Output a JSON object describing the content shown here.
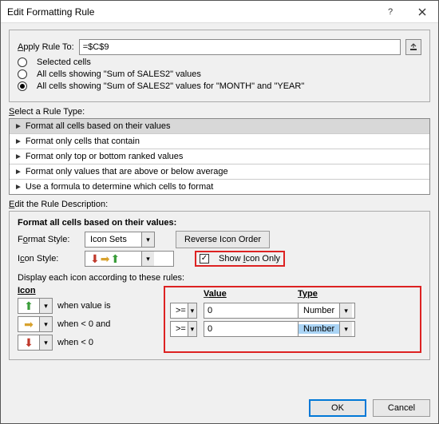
{
  "window": {
    "title": "Edit Formatting Rule"
  },
  "applyTo": {
    "label": "Apply Rule To:",
    "value": "=$C$9"
  },
  "scope": {
    "opt1": "Selected cells",
    "opt2": "All cells showing \"Sum of SALES2\" values",
    "opt3": "All cells showing \"Sum of SALES2\" values for \"MONTH\" and \"YEAR\""
  },
  "ruleType": {
    "label": "Select a Rule Type:",
    "items": [
      "Format all cells based on their values",
      "Format only cells that contain",
      "Format only top or bottom ranked values",
      "Format only values that are above or below average",
      "Use a formula to determine which cells to format"
    ]
  },
  "desc": {
    "label": "Edit the Rule Description:",
    "heading": "Format all cells based on their values:",
    "formatStyleLabel": "Format Style:",
    "formatStyle": "Icon Sets",
    "reverse": "Reverse Icon Order",
    "iconStyleLabel": "Icon Style:",
    "showIconOnly": "Show Icon Only",
    "rulesLabel": "Display each icon according to these rules:",
    "cols": {
      "icon": "Icon",
      "value": "Value",
      "type": "Type"
    },
    "rows": [
      {
        "text": "when value is",
        "op": ">=",
        "value": "0",
        "type": "Number"
      },
      {
        "text": "when < 0 and",
        "op": ">=",
        "value": "0",
        "type": "Number"
      },
      {
        "text": "when < 0"
      }
    ]
  },
  "buttons": {
    "ok": "OK",
    "cancel": "Cancel"
  }
}
